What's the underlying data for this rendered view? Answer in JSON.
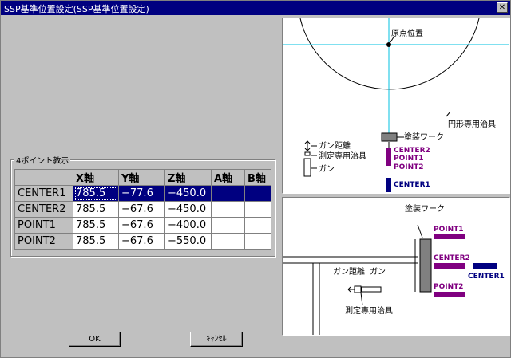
{
  "window": {
    "title": "SSP基準位置設定(SSP基準位置設定)"
  },
  "group": {
    "label": "4ポイント教示"
  },
  "table": {
    "columns": [
      "X軸",
      "Y軸",
      "Z軸",
      "A軸",
      "B軸"
    ],
    "rows": [
      {
        "name": "CENTER1",
        "x": "785.5",
        "y": "−77.6",
        "z": "−450.0",
        "a": "",
        "b": "",
        "selected": true
      },
      {
        "name": "CENTER2",
        "x": "785.5",
        "y": "−67.6",
        "z": "−450.0",
        "a": "",
        "b": ""
      },
      {
        "name": "POINT1",
        "x": "785.5",
        "y": "−67.6",
        "z": "−400.0",
        "a": "",
        "b": ""
      },
      {
        "name": "POINT2",
        "x": "785.5",
        "y": "−67.6",
        "z": "−550.0",
        "a": "",
        "b": ""
      }
    ]
  },
  "buttons": {
    "ok": "OK",
    "cancel": "ｷｬﾝｾﾙ"
  },
  "diagram_top": {
    "origin": "原点位置",
    "jig": "円形専用治具",
    "work": "塗装ワーク",
    "gun_distance": "ガン距離",
    "measure_jig": "測定専用治具",
    "gun": "ガン",
    "center2": "CENTER2",
    "point1": "POINT1",
    "point2": "POINT2",
    "center1": "CENTER1"
  },
  "diagram_bottom": {
    "work": "塗装ワーク",
    "point1": "POINT1",
    "center2": "CENTER2",
    "center1": "CENTER1",
    "point2": "POINT2",
    "gun_distance": "ガン距離",
    "gun": "ガン",
    "measure_jig": "測定専用治具"
  },
  "colors": {
    "titlebar": "#000080",
    "purple": "#800080",
    "navy": "#000080",
    "cyan": "#00c0e0"
  }
}
